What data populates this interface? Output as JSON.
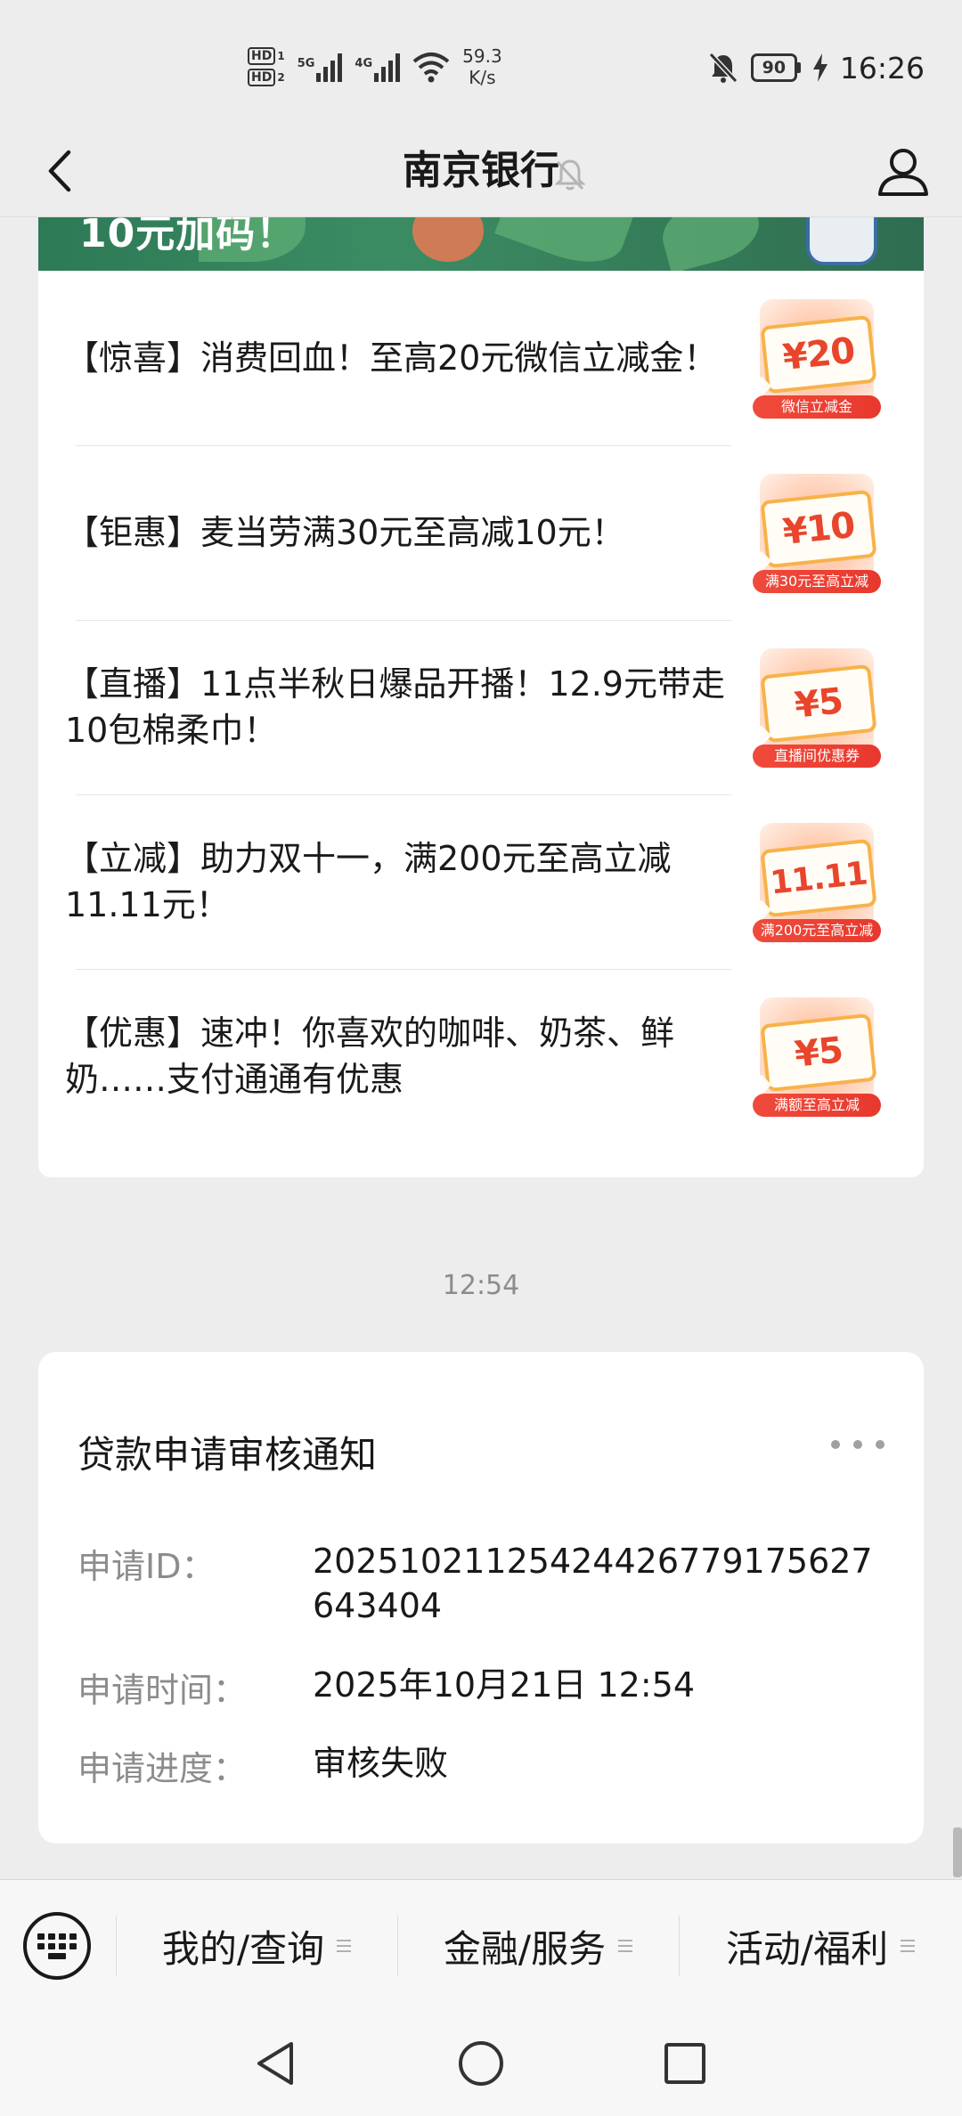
{
  "status_bar": {
    "sim1": "HD",
    "sim1_index": "1",
    "sim2": "HD",
    "sim2_index": "2",
    "net1": "5G",
    "net2": "4G",
    "speed_value": "59.3",
    "speed_unit": "K/s",
    "battery": "90",
    "time": "16:26",
    "icons": [
      "signal-icon",
      "wifi-icon",
      "mute-bell-icon",
      "battery-icon",
      "charging-icon"
    ]
  },
  "header": {
    "title": "南京银行",
    "icons": [
      "back-arrow-icon",
      "mute-bell-icon",
      "profile-icon"
    ]
  },
  "banner": {
    "text": "10元加码！"
  },
  "articles": [
    {
      "text": "【惊喜】消费回血！至高20元微信立减金！",
      "thumb_value": "¥20",
      "thumb_caption": "微信立减金"
    },
    {
      "text": "【钜惠】麦当劳满30元至高减10元！",
      "thumb_value": "¥10",
      "thumb_caption": "满30元至高立减"
    },
    {
      "text": "【直播】11点半秋日爆品开播！12.9元带走10包棉柔巾！",
      "thumb_value": "¥5",
      "thumb_caption": "直播间优惠券"
    },
    {
      "text": "【立减】助力双十一，满200元至高立减11.11元！",
      "thumb_value": "11.11",
      "thumb_caption": "满200元至高立减"
    },
    {
      "text": "【优惠】速冲！你喜欢的咖啡、奶茶、鲜奶……支付通通有优惠",
      "thumb_value": "¥5",
      "thumb_caption": "满额至高立减"
    }
  ],
  "timestamp": "12:54",
  "notice": {
    "title": "贷款申请审核通知",
    "fields": [
      {
        "label": "申请ID：",
        "value": "20251021125424426779175627643404"
      },
      {
        "label": "申请时间：",
        "value": "2025年10月21日 12:54"
      },
      {
        "label": "申请进度：",
        "value": "审核失败"
      }
    ]
  },
  "bottom_menu": {
    "items": [
      {
        "label": "我的/查询"
      },
      {
        "label": "金融/服务"
      },
      {
        "label": "活动/福利"
      }
    ]
  },
  "colors": {
    "background": "#ededed",
    "card": "#ffffff",
    "banner_green": "#2d7a56",
    "coupon_red": "#e8452c",
    "muted_text": "#8c8c8c"
  }
}
